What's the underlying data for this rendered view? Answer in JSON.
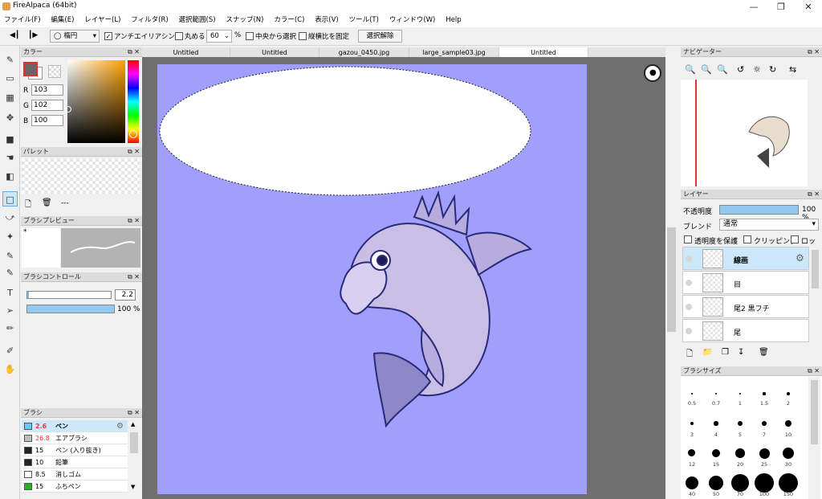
{
  "window": {
    "title": "FireAlpaca (64bit)"
  },
  "menu": [
    "ファイル(F)",
    "編集(E)",
    "レイヤー(L)",
    "フィルタ(R)",
    "選択範囲(S)",
    "スナップ(N)",
    "カラー(C)",
    "表示(V)",
    "ツール(T)",
    "ウィンドウ(W)",
    "Help"
  ],
  "toolbar": {
    "shape": "楕円",
    "antialias": "アンチエイリアシング",
    "round": "丸める",
    "round_value": "60",
    "percent": "%",
    "from_center": "中央から選択",
    "fix_ratio": "縦横比を固定",
    "deselect": "選択解除"
  },
  "tabs": [
    "Untitled",
    "Untitled",
    "gazou_0450.jpg",
    "large_sample03.jpg",
    "Untitled"
  ],
  "color_panel": {
    "title": "カラー",
    "r_label": "R",
    "g_label": "G",
    "b_label": "B",
    "r": "103",
    "g": "102",
    "b": "100",
    "fg": "#676664"
  },
  "palette_panel": {
    "title": "パレット",
    "dashes": "---"
  },
  "brush_preview": {
    "title": "ブラシプレビュー",
    "mark": "*"
  },
  "brush_control": {
    "title": "ブラシコントロール",
    "size": "2.2",
    "opacity": "100 %",
    "opacity_fill": 1.0
  },
  "brush_panel": {
    "title": "ブラシ",
    "items": [
      {
        "size": "2.6",
        "name": "ペン",
        "color": "#6ac8f0"
      },
      {
        "size": "26.8",
        "name": "エアブラシ",
        "color": "#bfbfbf"
      },
      {
        "size": "15",
        "name": "ペン (入り抜き)",
        "color": "#222222"
      },
      {
        "size": "10",
        "name": "鉛筆",
        "color": "#222222"
      },
      {
        "size": "8.5",
        "name": "消しゴム",
        "color": "#ffffff"
      },
      {
        "size": "15",
        "name": "ふちペン",
        "color": "#21b521"
      }
    ]
  },
  "navigator": {
    "title": "ナビゲーター"
  },
  "layer_panel": {
    "title": "レイヤー",
    "opacity_label": "不透明度",
    "opacity_value": "100 %",
    "opacity_fill": 1.0,
    "blend_label": "ブレンド",
    "blend_value": "通常",
    "protect_alpha": "透明度を保護",
    "clipping": "クリッピング",
    "lock": "ロック",
    "layers": [
      "線画",
      "目",
      "尾2 黒フチ",
      "尾"
    ]
  },
  "brush_size_panel": {
    "title": "ブラシサイズ",
    "sizes": [
      "0.5",
      "0.7",
      "1",
      "1.5",
      "2",
      "3",
      "4",
      "5",
      "7",
      "10",
      "12",
      "15",
      "20",
      "25",
      "30",
      "40",
      "50",
      "70",
      "100",
      "150"
    ]
  }
}
